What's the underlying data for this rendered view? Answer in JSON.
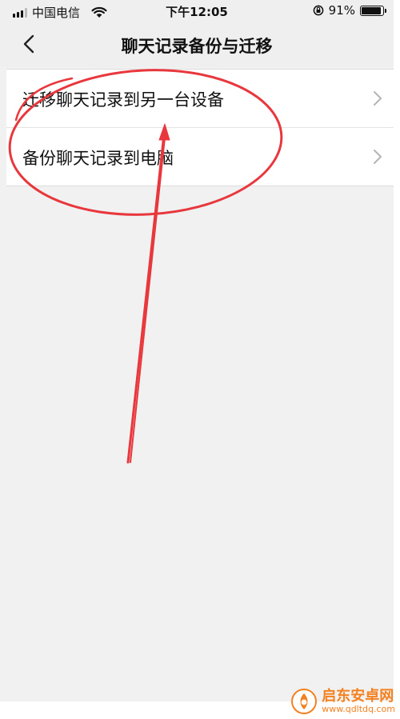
{
  "status_bar": {
    "carrier": "中国电信",
    "time": "下午12:05",
    "battery_text": "91%",
    "battery_level": 0.91
  },
  "nav": {
    "title": "聊天记录备份与迁移",
    "back_icon": "chevron-left-icon"
  },
  "list": {
    "items": [
      {
        "label": "迁移聊天记录到另一台设备",
        "icon": "chevron-right-icon"
      },
      {
        "label": "备份聊天记录到电脑",
        "icon": "chevron-right-icon"
      }
    ]
  },
  "annotation": {
    "color": "#e8383d"
  },
  "watermark": {
    "name": "启东安卓网",
    "url": "www.qdltdq.com",
    "color": "#f4811f"
  }
}
